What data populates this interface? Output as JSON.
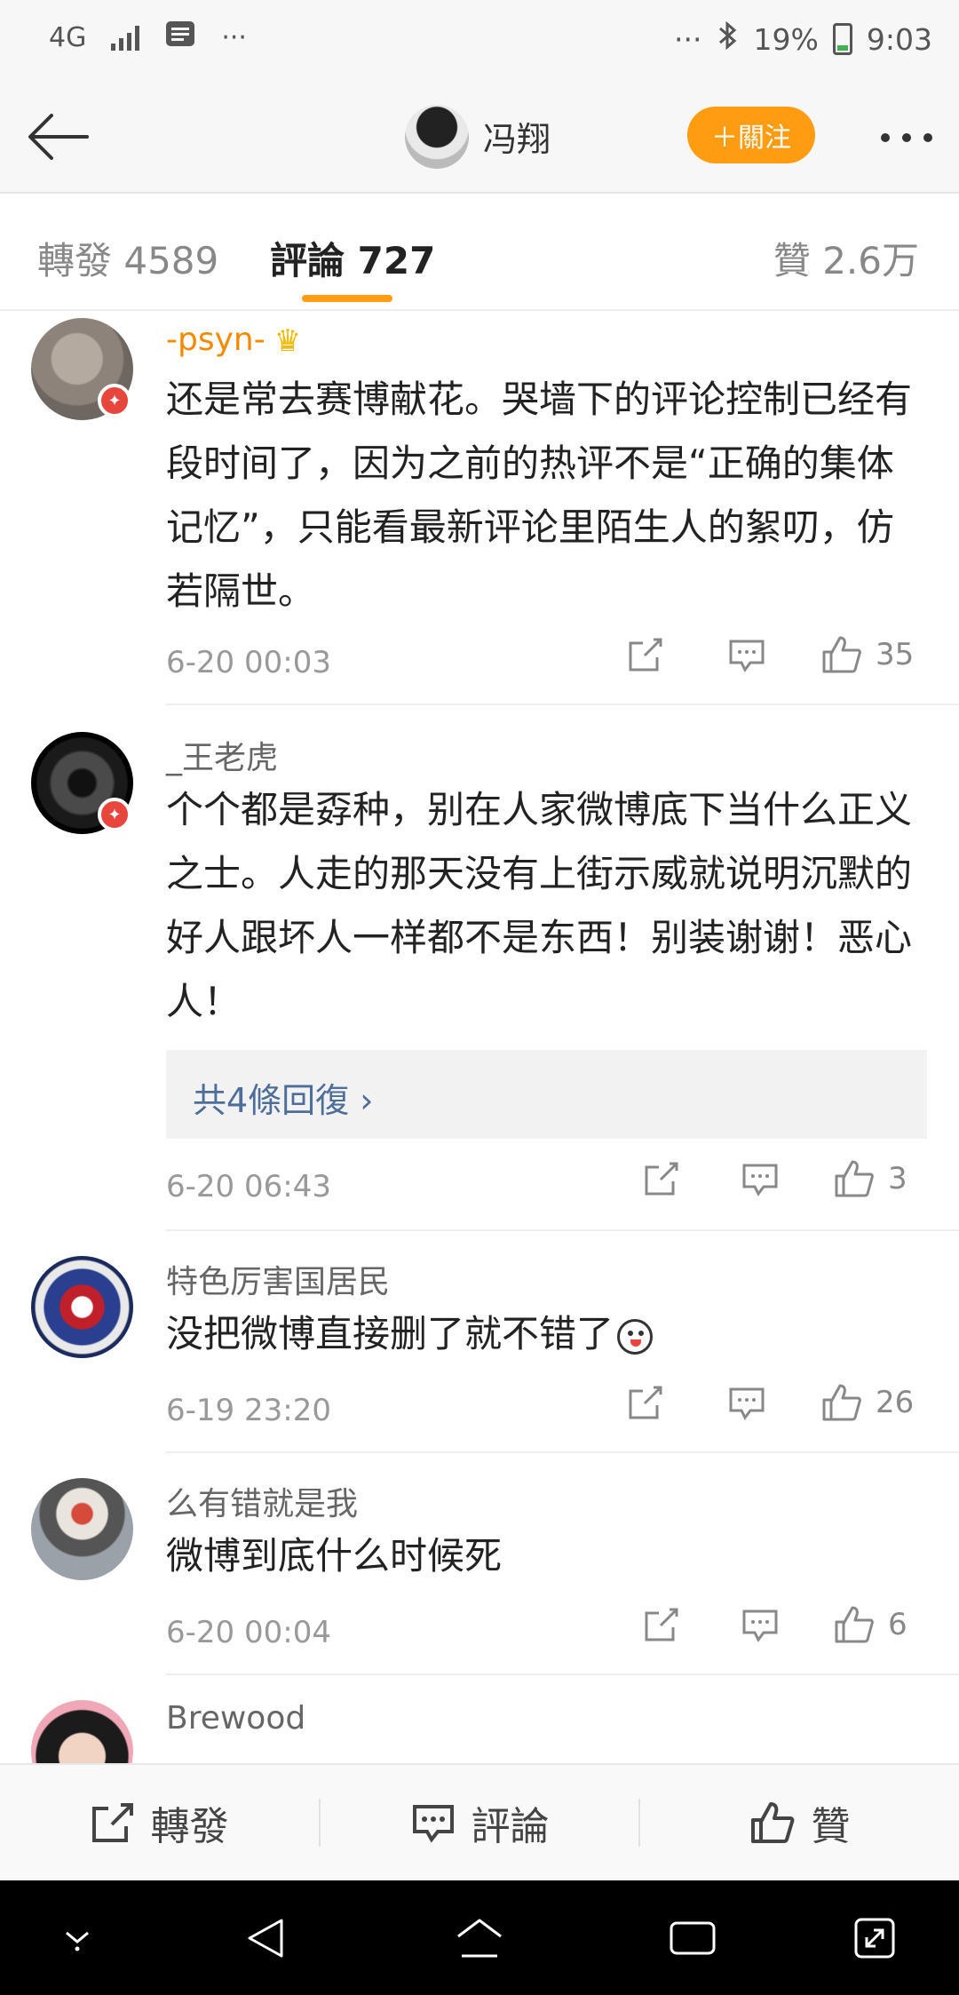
{
  "status_bar": {
    "network": "4G",
    "more": "···",
    "more_right": "···",
    "battery": "19%",
    "time": "9:03"
  },
  "nav": {
    "user_name": "冯翔",
    "follow_label": "＋關注"
  },
  "tabs": {
    "repost": "轉發 4589",
    "comments": "評論 727",
    "likes": "贊 2.6万"
  },
  "comments": [
    {
      "name": "-psyn-",
      "text": "还是常去赛博献花。哭墙下的评论控制已经有段时间了，因为之前的热评不是“正确的集体记忆”，只能看最新评论里陌生人的絮叨，仿若隔世。",
      "time": "6-20 00:03",
      "likes": "35"
    },
    {
      "name": "_王老虎",
      "text": "个个都是孬种，别在人家微博底下当什么正义之士。人走的那天没有上街示威就说明沉默的好人跟坏人一样都不是东西！别装谢谢！恶心人！",
      "replies_label": "共4條回復 ›",
      "time": "6-20 06:43",
      "likes": "3"
    },
    {
      "name": "特色厉害国居民",
      "text": "没把微博直接删了就不错了",
      "time": "6-19 23:20",
      "likes": "26"
    },
    {
      "name": "么有错就是我",
      "text": "微博到底什么时候死",
      "time": "6-20 00:04",
      "likes": "6"
    },
    {
      "name": "Brewood"
    }
  ],
  "bottom_bar": {
    "repost": "轉發",
    "comment": "評論",
    "like": "贊"
  },
  "colors": {
    "accent": "#ff9c12",
    "link": "#4d6e99",
    "badge": "#e8453c"
  }
}
